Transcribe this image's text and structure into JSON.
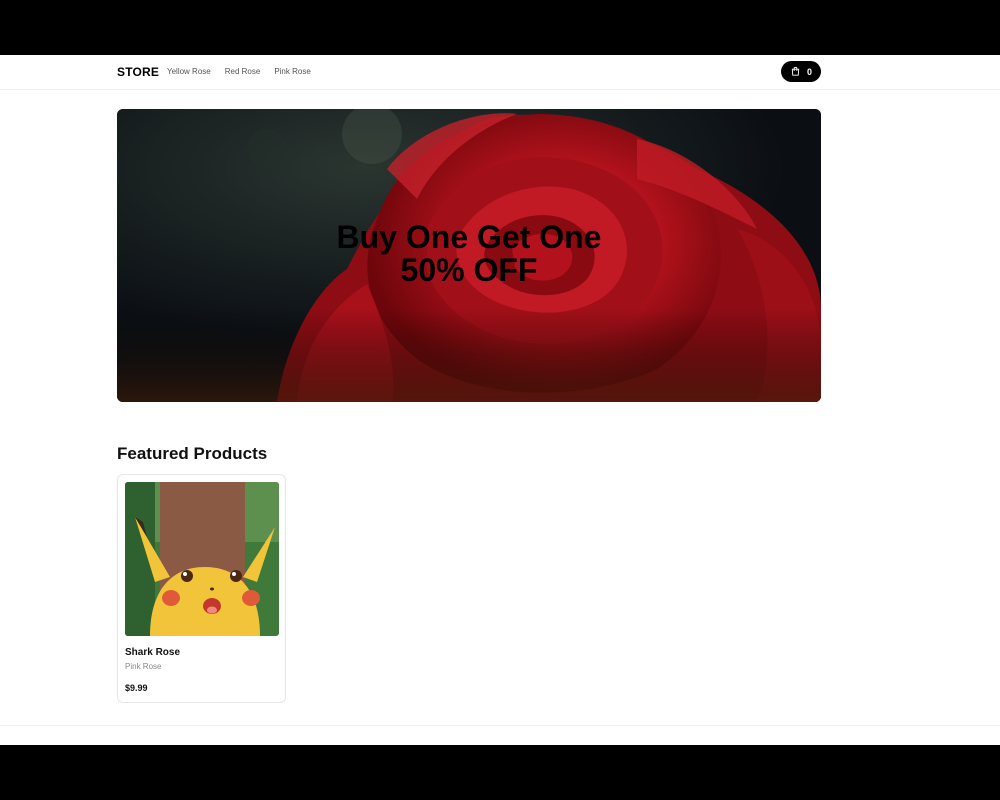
{
  "nav": {
    "brand": "STORE",
    "links": [
      "Yellow Rose",
      "Red Rose",
      "Pink Rose"
    ],
    "cart_count": "0"
  },
  "hero": {
    "line1": "Buy One Get One",
    "line2": "50% OFF"
  },
  "featured": {
    "title": "Featured Products",
    "products": [
      {
        "name": "Shark Rose",
        "category": "Pink Rose",
        "price": "$9.99"
      }
    ]
  },
  "icons": {
    "cart": "shopping-bag-icon"
  },
  "colors": {
    "accent": "#000000",
    "rose": "#b3121c"
  }
}
